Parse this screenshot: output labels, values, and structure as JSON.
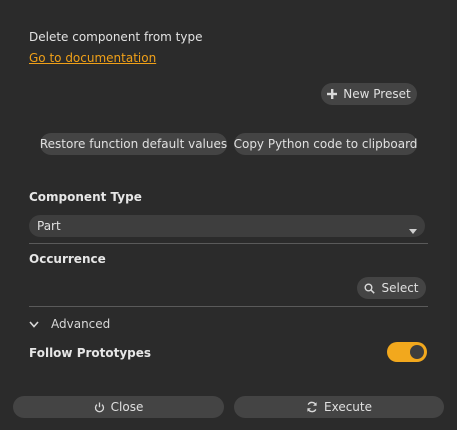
{
  "description": "Delete component from type",
  "doc_link": "Go to documentation",
  "presets": {
    "new_preset_label": "New Preset"
  },
  "actions": {
    "restore_label": "Restore function default values",
    "copy_label": "Copy Python code to clipboard"
  },
  "component_type": {
    "label": "Component Type",
    "selected": "Part"
  },
  "occurrence": {
    "label": "Occurrence",
    "select_label": "Select"
  },
  "advanced": {
    "label": "Advanced",
    "expanded": true
  },
  "follow_prototypes": {
    "label": "Follow Prototypes",
    "enabled": true
  },
  "footer": {
    "close_label": "Close",
    "execute_label": "Execute"
  },
  "colors": {
    "background": "#2b2b2b",
    "accent": "#f2a81d",
    "link": "#f0a018",
    "button": "#444444"
  }
}
